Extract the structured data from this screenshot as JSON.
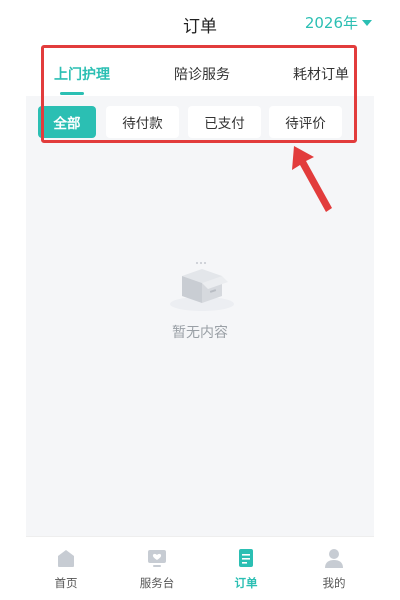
{
  "header": {
    "title": "订单",
    "year": "2026年"
  },
  "category_tabs": [
    {
      "label": "上门护理",
      "active": true
    },
    {
      "label": "陪诊服务",
      "active": false
    },
    {
      "label": "耗材订单",
      "active": false
    }
  ],
  "status_filters": [
    {
      "label": "全部",
      "active": true
    },
    {
      "label": "待付款",
      "active": false
    },
    {
      "label": "已支付",
      "active": false
    },
    {
      "label": "待评价",
      "active": false
    }
  ],
  "empty_state": {
    "text": "暂无内容",
    "icon": "empty-box-icon"
  },
  "bottom_nav": [
    {
      "label": "首页",
      "icon": "home-icon",
      "active": false
    },
    {
      "label": "服务台",
      "icon": "service-desk-icon",
      "active": false
    },
    {
      "label": "订单",
      "icon": "order-icon",
      "active": true
    },
    {
      "label": "我的",
      "icon": "profile-icon",
      "active": false
    }
  ],
  "colors": {
    "accent": "#2bbfb3",
    "annotation": "#e23c3c",
    "background": "#f5f6f8"
  }
}
